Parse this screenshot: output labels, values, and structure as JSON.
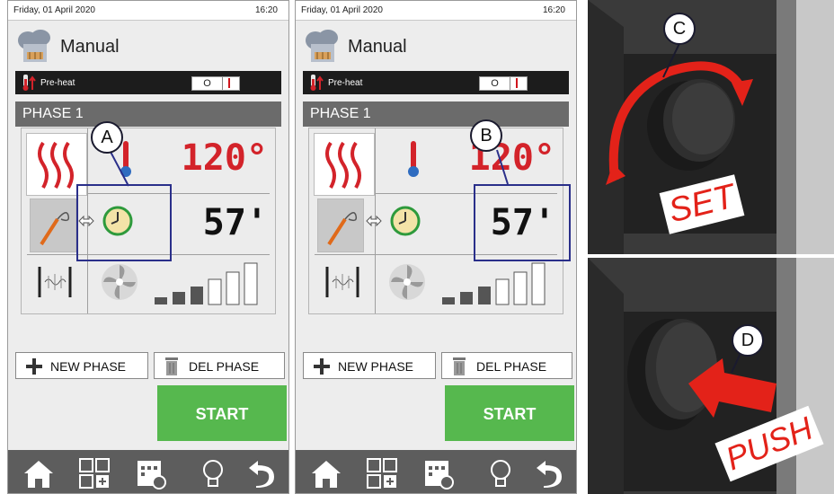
{
  "screens": [
    {
      "date": "Friday, 01 April 2020",
      "time": "16:20",
      "mode_title": "Manual",
      "preheat_label": "Pre-heat",
      "toggle_off": "O",
      "phase_label": "PHASE 1",
      "temperature": "120°",
      "duration": "57'",
      "new_phase": "NEW PHASE",
      "del_phase": "DEL PHASE",
      "start": "START",
      "callout": "A"
    },
    {
      "date": "Friday, 01 April 2020",
      "time": "16:20",
      "mode_title": "Manual",
      "preheat_label": "Pre-heat",
      "toggle_off": "O",
      "phase_label": "PHASE 1",
      "temperature": "120°",
      "duration": "57'",
      "new_phase": "NEW PHASE",
      "del_phase": "DEL PHASE",
      "start": "START",
      "callout": "B"
    }
  ],
  "fan_speed_level": "3 of 6",
  "photos": {
    "top_callout": "C",
    "top_label": "SET",
    "bottom_callout": "D",
    "bottom_label": "PUSH"
  },
  "icons": [
    "chef-hat-icon",
    "thermometer-icon",
    "heat-waves-icon",
    "probe-icon",
    "clock-icon",
    "fan-icon",
    "humidity-icon",
    "plus-icon",
    "trash-icon",
    "home-icon",
    "grid-add-icon",
    "calendar-icon",
    "bulb-icon",
    "back-icon"
  ],
  "colors": {
    "accent_red": "#d3232a",
    "start_green": "#56b84e",
    "frame_blue": "#2a2f8a"
  }
}
